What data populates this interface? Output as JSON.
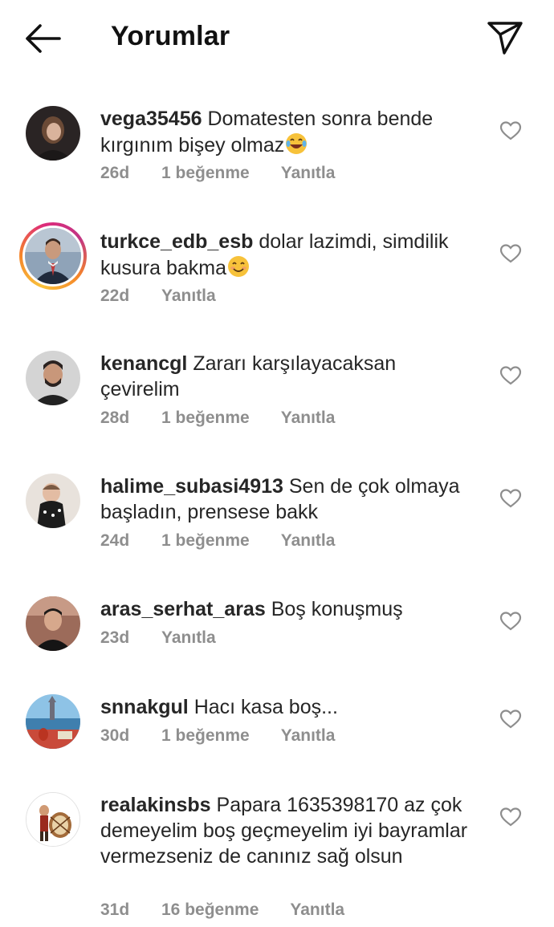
{
  "header": {
    "title": "Yorumlar",
    "back_icon": "arrow-left-icon",
    "share_icon": "paper-plane-icon"
  },
  "comments": [
    {
      "username": "vega35456",
      "text": "Domatesten sonra bende kırgınım bişey olmaz",
      "emoji": "tears-of-joy",
      "time": "26d",
      "likes": "1 beğenme",
      "reply": "Yanıtla"
    },
    {
      "username": "turkce_edb_esb",
      "text": "dolar lazimdi, simdilik kusura bakma",
      "emoji": "smiling-face",
      "time": "22d",
      "likes": "",
      "reply": "Yanıtla"
    },
    {
      "username": "kenancgl",
      "text": "Zararı karşılayacaksan çevirelim",
      "time": "28d",
      "likes": "1 beğenme",
      "reply": "Yanıtla"
    },
    {
      "username": "halime_subasi4913",
      "text": "Sen de çok olmaya başladın, prensese bakk",
      "time": "24d",
      "likes": "1 beğenme",
      "reply": "Yanıtla"
    },
    {
      "username": "aras_serhat_aras",
      "text": "Boş konuşmuş",
      "time": "23d",
      "likes": "",
      "reply": "Yanıtla"
    },
    {
      "username": "snnakgul",
      "text": "Hacı kasa boş...",
      "time": "30d",
      "likes": "1 beğenme",
      "reply": "Yanıtla"
    },
    {
      "username": "realakinsbs",
      "text": "Papara 1635398170 az çok demeyelim boş geçmeyelim iyi bayramlar vermezseniz de canınız sağ olsun",
      "time": "31d",
      "likes": "16 beğenme",
      "reply": "Yanıtla"
    }
  ],
  "colors": {
    "text": "#262626",
    "meta": "#8e8e8e",
    "heart": "#8e8e8e"
  },
  "icons": {
    "like": "heart-outline-icon"
  }
}
